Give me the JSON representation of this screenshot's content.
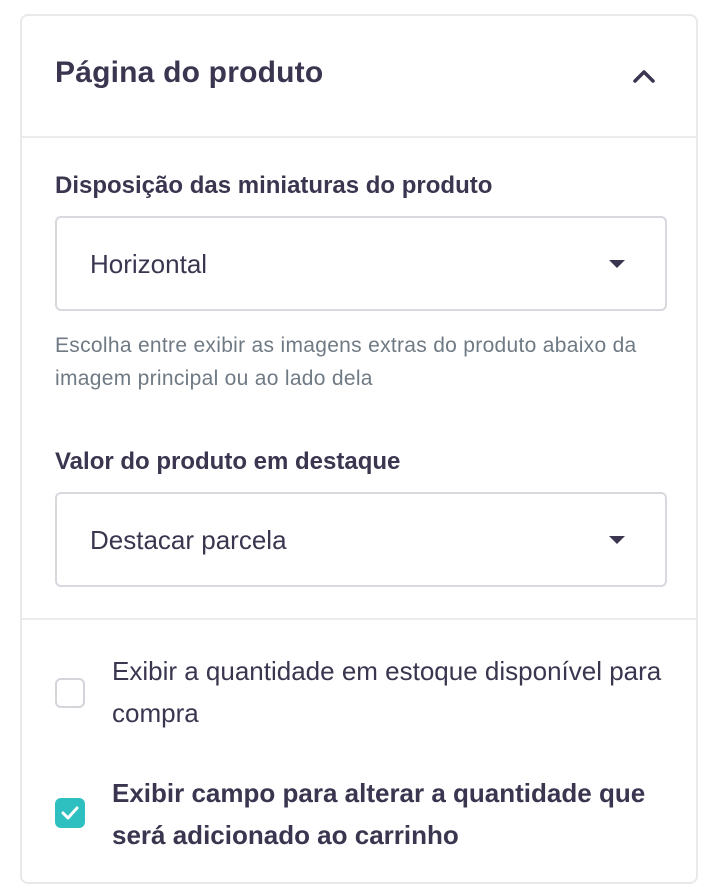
{
  "panel": {
    "title": "Página do produto",
    "collapse_icon": "chevron-up-icon"
  },
  "thumbnails": {
    "label": "Disposição das miniaturas do produto",
    "selected": "Horizontal",
    "help": "Escolha entre exibir as imagens extras do produto abaixo da imagem principal ou ao lado dela"
  },
  "price_highlight": {
    "label": "Valor do produto em destaque",
    "selected": "Destacar parcela"
  },
  "options": [
    {
      "label": "Exibir a quantidade em estoque disponível para compra",
      "checked": false
    },
    {
      "label": "Exibir campo para alterar a quantidade que será adicionado ao carrinho",
      "checked": true
    }
  ],
  "colors": {
    "text": "#3b3550",
    "muted": "#6f7a84",
    "accent": "#2ebfc0",
    "border": "#d8d8de"
  }
}
